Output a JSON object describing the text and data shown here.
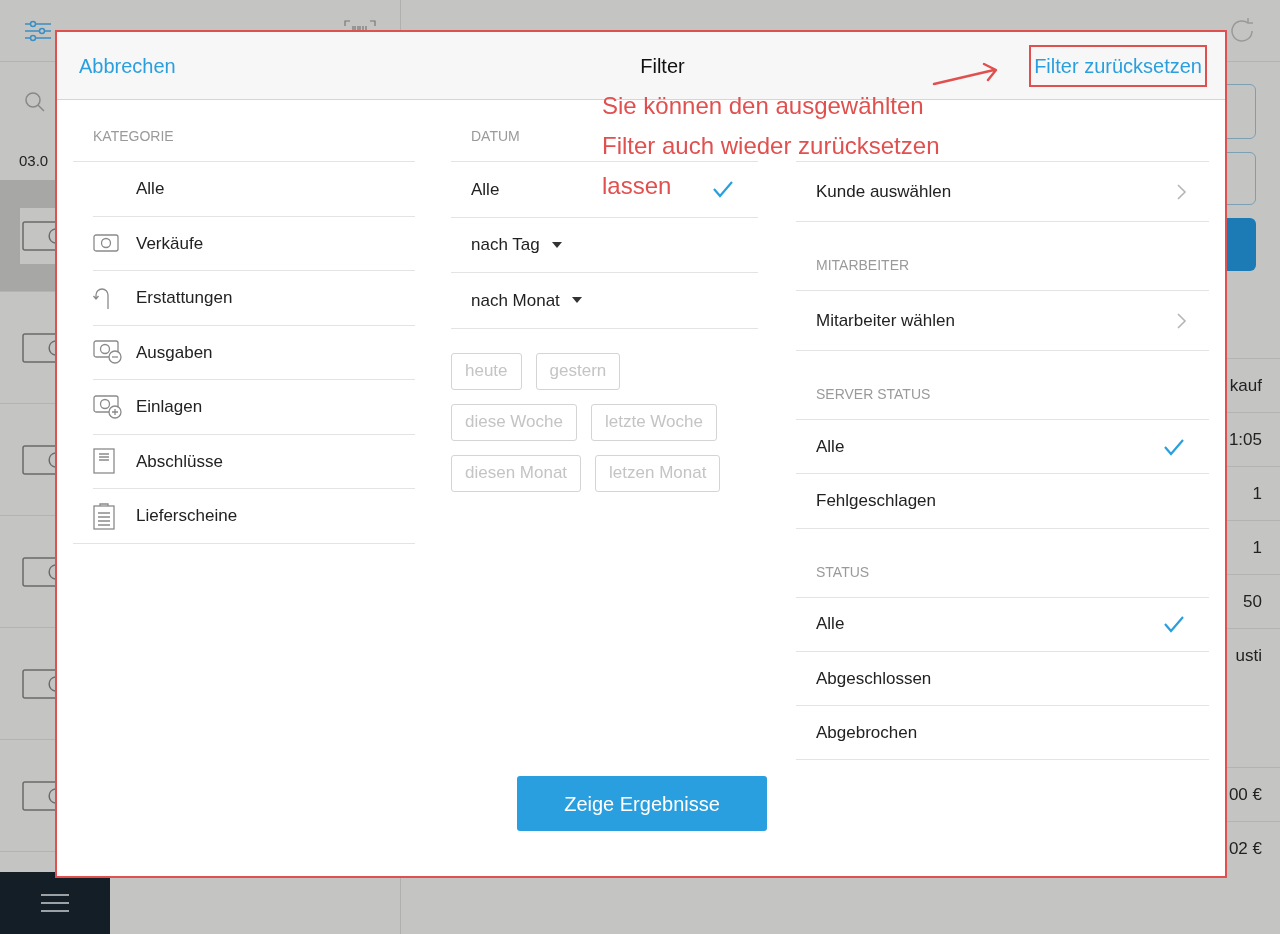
{
  "background": {
    "first_date": "03.0",
    "list_rows": [
      {
        "selected": true
      },
      {
        "selected": false
      },
      {
        "selected": false
      },
      {
        "selected": false
      },
      {
        "selected": false
      },
      {
        "selected": false
      }
    ],
    "receipt_values": [
      "kauf",
      "1:05",
      "1",
      "1",
      "50",
      "usti",
      "00 €",
      "02 €"
    ]
  },
  "dialog": {
    "cancel": "Abbrechen",
    "title": "Filter",
    "reset": "Filter zurücksetzen",
    "category": {
      "heading": "KATEGORIE",
      "items": [
        "Alle",
        "Verkäufe",
        "Erstattungen",
        "Ausgaben",
        "Einlagen",
        "Abschlüsse",
        "Lieferscheine"
      ]
    },
    "date": {
      "heading": "DATUM",
      "options": [
        {
          "label": "Alle",
          "kind": "plain",
          "selected": true
        },
        {
          "label": "nach Tag",
          "kind": "dropdown",
          "selected": false
        },
        {
          "label": "nach Monat",
          "kind": "dropdown",
          "selected": false
        }
      ],
      "quick_ranges": [
        [
          "heute",
          "gestern"
        ],
        [
          "diese Woche",
          "letzte Woche"
        ],
        [
          "diesen Monat",
          "letzen Monat"
        ]
      ]
    },
    "customer": {
      "value": "Kunde auswählen"
    },
    "employee": {
      "heading": "MITARBEITER",
      "value": "Mitarbeiter wählen"
    },
    "server_status": {
      "heading": "SERVER STATUS",
      "options": [
        {
          "label": "Alle",
          "selected": true
        },
        {
          "label": "Fehlgeschlagen",
          "selected": false
        }
      ]
    },
    "status": {
      "heading": "STATUS",
      "options": [
        {
          "label": "Alle",
          "selected": true
        },
        {
          "label": "Abgeschlossen",
          "selected": false
        },
        {
          "label": "Abgebrochen",
          "selected": false
        }
      ]
    },
    "submit": "Zeige Ergebnisse"
  },
  "annotation": {
    "lines": [
      "Sie können den ausgewählten",
      "Filter auch wieder zurücksetzen",
      "lassen"
    ]
  }
}
